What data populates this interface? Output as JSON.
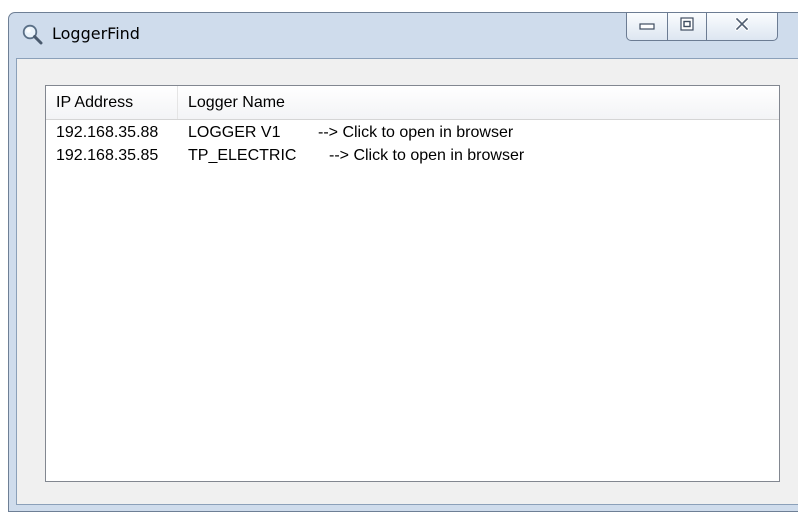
{
  "window": {
    "title": "LoggerFind",
    "icon": "search-icon",
    "buttons": {
      "minimize": "minimize-icon",
      "maximize": "maximize-icon",
      "close": "close-icon"
    }
  },
  "list": {
    "columns": [
      "IP Address",
      "Logger Name"
    ],
    "rows": [
      {
        "ip": "192.168.35.88",
        "name": "LOGGER V1",
        "action": "--> Click to open in browser"
      },
      {
        "ip": "192.168.35.85",
        "name": "TP_ELECTRIC",
        "action": "--> Click to open in browser"
      }
    ]
  }
}
